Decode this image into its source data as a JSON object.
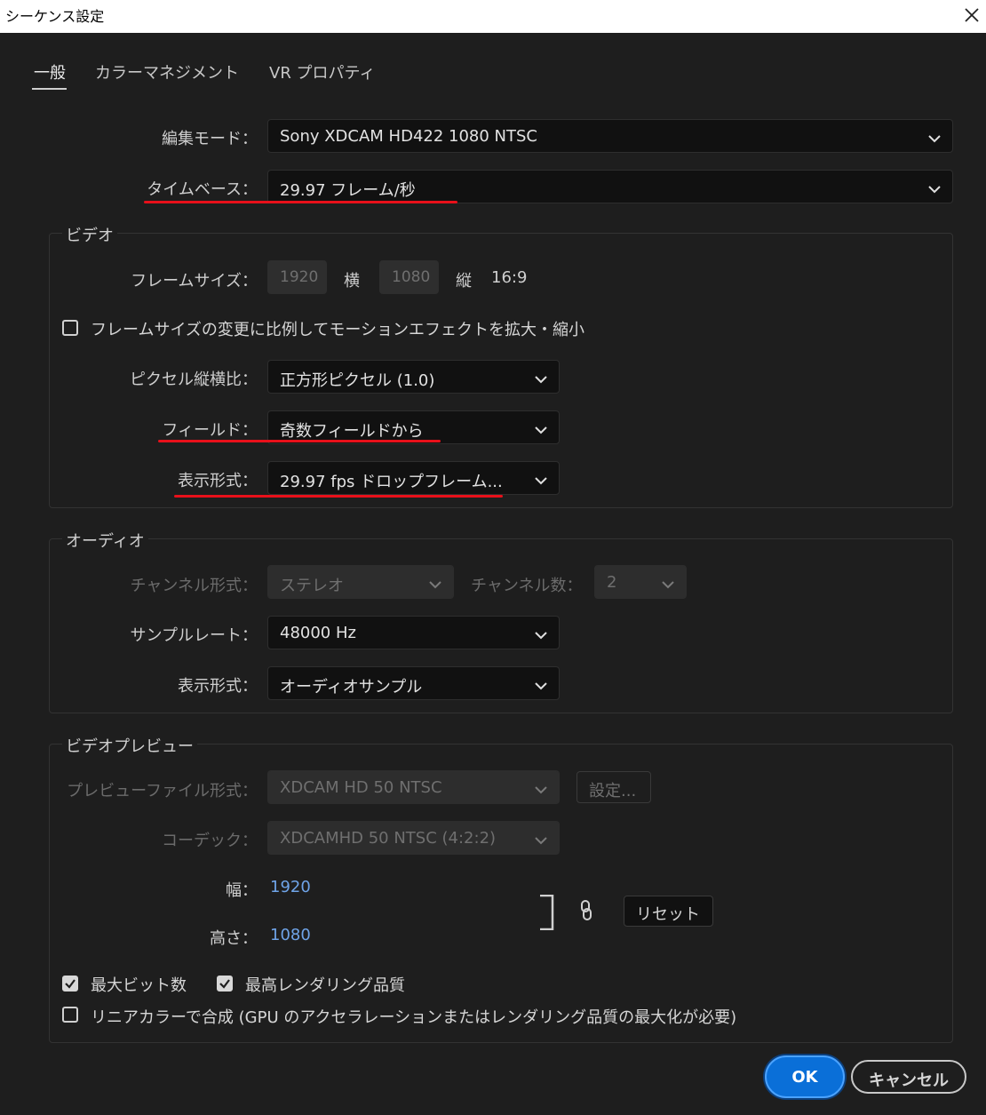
{
  "window": {
    "title": "シーケンス設定"
  },
  "tabs": [
    {
      "label": "一般"
    },
    {
      "label": "カラーマネジメント"
    },
    {
      "label": "VR プロパティ"
    }
  ],
  "general": {
    "edit_mode_label": "編集モード：",
    "edit_mode_value": "Sony XDCAM HD422 1080 NTSC",
    "timebase_label": "タイムベース：",
    "timebase_value": "29.97  フレーム/秒"
  },
  "video": {
    "title": "ビデオ",
    "frame_size_label": "フレームサイズ：",
    "width_value": "1920",
    "width_unit": "横",
    "height_value": "1080",
    "height_unit": "縦",
    "aspect": "16:9",
    "scale_motion_label": "フレームサイズの変更に比例してモーションエフェクトを拡大・縮小",
    "pixel_aspect_label": "ピクセル縦横比：",
    "pixel_aspect_value": "正方形ピクセル (1.0)",
    "fields_label": "フィールド：",
    "fields_value": "奇数フィールドから",
    "display_format_label": "表示形式：",
    "display_format_value": "29.97  fps ドロップフレーム..."
  },
  "audio": {
    "title": "オーディオ",
    "channel_format_label": "チャンネル形式：",
    "channel_format_value": "ステレオ",
    "channel_count_label": "チャンネル数：",
    "channel_count_value": "2",
    "sample_rate_label": "サンプルレート：",
    "sample_rate_value": "48000 Hz",
    "display_format_label": "表示形式：",
    "display_format_value": "オーディオサンプル"
  },
  "preview": {
    "title": "ビデオプレビュー",
    "file_format_label": "プレビューファイル形式：",
    "file_format_value": "XDCAM HD 50 NTSC",
    "settings_button": "設定...",
    "codec_label": "コーデック：",
    "codec_value": "XDCAMHD 50 NTSC (4:2:2)",
    "width_label": "幅：",
    "width_value": "1920",
    "height_label": "高さ：",
    "height_value": "1080",
    "reset_button": "リセット"
  },
  "options": {
    "max_bit_depth": {
      "label": "最大ビット数",
      "checked": true
    },
    "max_render_quality": {
      "label": "最高レンダリング品質",
      "checked": true
    },
    "linear_color": {
      "label": "リニアカラーで合成 (GPU のアクセラレーションまたはレンダリング品質の最大化が必要)",
      "checked": false
    }
  },
  "buttons": {
    "ok": "OK",
    "cancel": "キャンセル"
  },
  "colors": {
    "accent": "#0a6fd8",
    "annotation": "#e8101a",
    "link": "#6fa4e8",
    "background": "#1e1e1e"
  }
}
